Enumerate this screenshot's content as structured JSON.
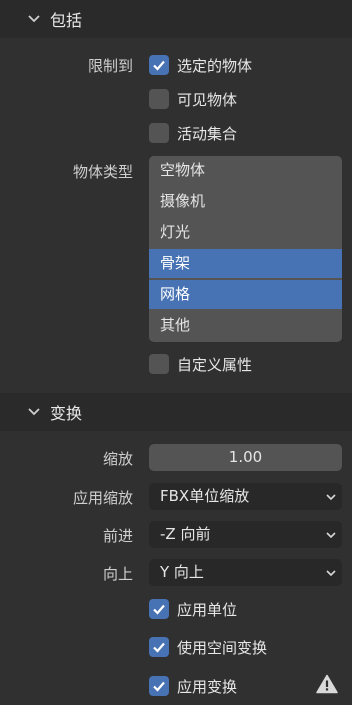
{
  "include": {
    "title": "包括",
    "limit_to_label": "限制到",
    "limit_options": [
      {
        "label": "选定的物体",
        "checked": true
      },
      {
        "label": "可见物体",
        "checked": false
      },
      {
        "label": "活动集合",
        "checked": false
      }
    ],
    "object_types_label": "物体类型",
    "object_types": [
      {
        "label": "空物体",
        "selected": false
      },
      {
        "label": "摄像机",
        "selected": false
      },
      {
        "label": "灯光",
        "selected": false
      },
      {
        "label": "骨架",
        "selected": true
      },
      {
        "label": "网格",
        "selected": true
      },
      {
        "label": "其他",
        "selected": false
      }
    ],
    "custom_props": {
      "label": "自定义属性",
      "checked": false
    }
  },
  "transform": {
    "title": "变换",
    "scale_label": "缩放",
    "scale_value": "1.00",
    "apply_scaling_label": "应用缩放",
    "apply_scaling_value": "FBX单位缩放",
    "forward_label": "前进",
    "forward_value": "-Z 向前",
    "up_label": "向上",
    "up_value": "Y 向上",
    "apply_unit": {
      "label": "应用单位",
      "checked": true
    },
    "use_space_transform": {
      "label": "使用空间变换",
      "checked": true
    },
    "apply_transform": {
      "label": "应用变换",
      "checked": true
    }
  },
  "icons": {
    "section_chevron": "chevron-down-icon",
    "checkmark": "checkmark-icon",
    "dropdown_arrow": "dropdown-arrow-icon",
    "warning": "warning-icon"
  },
  "colors": {
    "accent": "#4772b3",
    "panel_bg": "#303030",
    "header_bg": "#2a2a2a",
    "field_bg": "#545454",
    "dropdown_bg": "#282828"
  }
}
